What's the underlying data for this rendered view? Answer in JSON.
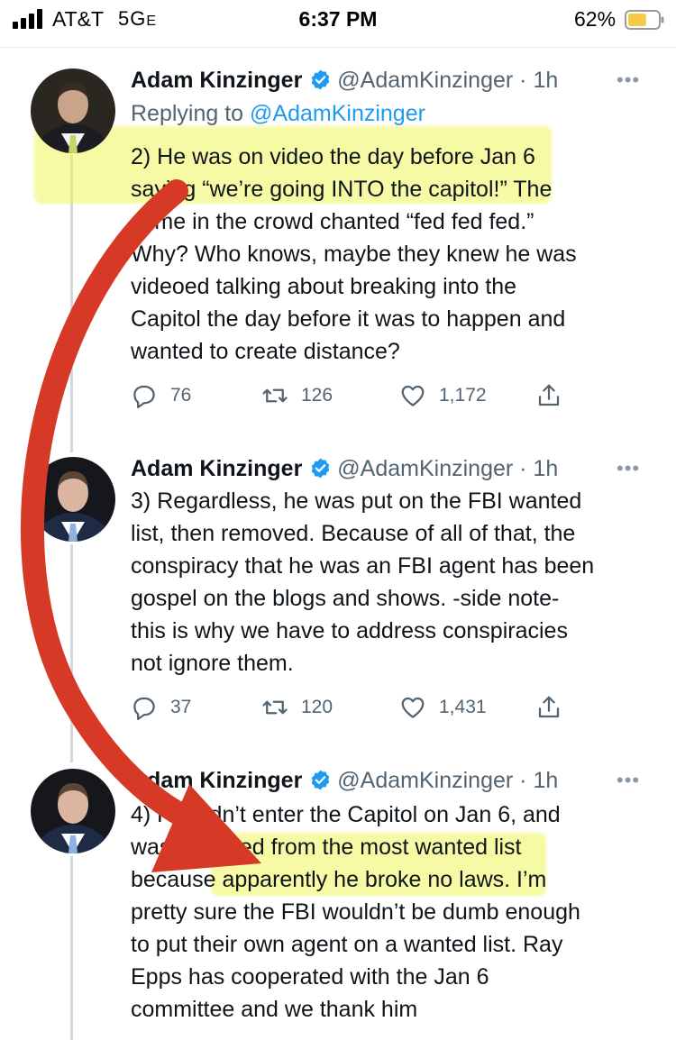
{
  "status_bar": {
    "carrier": "AT&T",
    "network": "5G",
    "network_suffix": "E",
    "time": "6:37 PM",
    "battery_percent": "62%",
    "battery_level": 0.62,
    "battery_color": "#f7c948"
  },
  "reply_context": {
    "label": "Replying to",
    "mention": "@AdamKinzinger"
  },
  "tweets": [
    {
      "name": "Adam Kinzinger",
      "handle": "@AdamKinzinger",
      "time": "· 1h",
      "lines": [
        "2) He was on video the day before Jan 6",
        "saying “we’re going INTO the capitol!”  The",
        "some in the crowd chanted “fed fed fed.”",
        "Why?  Who knows, maybe they knew he was",
        "videoed talking about breaking into the",
        "Capitol the day before it was to happen and",
        "wanted to create distance?"
      ],
      "replies": "76",
      "retweets": "126",
      "likes": "1,172"
    },
    {
      "name": "Adam Kinzinger",
      "handle": "@AdamKinzinger",
      "time": "· 1h",
      "lines": [
        "3) Regardless, he was put on the FBI wanted",
        "list, then removed.  Because of all of that, the",
        "conspiracy that he was an FBI agent has been",
        "gospel on the blogs and shows.  -side note-",
        "this is why we have to address conspiracies",
        "not ignore them."
      ],
      "replies": "37",
      "retweets": "120",
      "likes": "1,431"
    },
    {
      "name": "Adam Kinzinger",
      "handle": "@AdamKinzinger",
      "time": "· 1h",
      "lines": [
        "4) He didn’t enter the Capitol on Jan 6, and",
        "was removed from the most wanted list",
        "because apparently he broke no laws.  I’m",
        "pretty sure the FBI wouldn’t be dumb enough",
        "to put their own agent on a wanted list.  Ray",
        "Epps has cooperated with the Jan 6",
        "committee and we thank him"
      ]
    }
  ],
  "more_glyph": "•••",
  "icons": {
    "reply": "reply-icon",
    "retweet": "retweet-icon",
    "like": "heart-icon",
    "share": "share-icon",
    "verified": "verified-badge-icon"
  },
  "colors": {
    "highlight": "#f1f55a",
    "arrow": "#d63a26",
    "verified": "#1d9bf0",
    "link": "#1d9bf0"
  }
}
